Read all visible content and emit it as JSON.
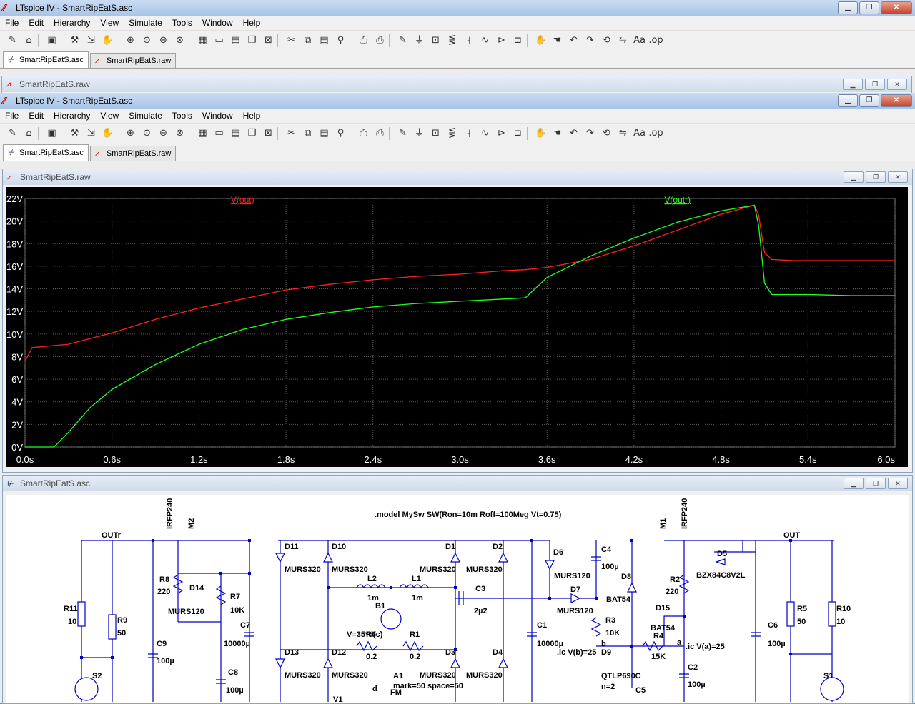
{
  "back_window": {
    "title": "LTspice IV - SmartRipEatS.asc",
    "menu": [
      "File",
      "Edit",
      "Hierarchy",
      "View",
      "Simulate",
      "Tools",
      "Window",
      "Help"
    ],
    "tabs": [
      "SmartRipEatS.asc",
      "SmartRipEatS.raw"
    ],
    "child_title": "SmartRipEatS.raw"
  },
  "main_window": {
    "title": "LTspice IV - SmartRipEatS.asc",
    "menu": [
      "File",
      "Edit",
      "Hierarchy",
      "View",
      "Simulate",
      "Tools",
      "Window",
      "Help"
    ],
    "tabs": [
      "SmartRipEatS.asc",
      "SmartRipEatS.raw"
    ]
  },
  "toolbar_icons": [
    "new-schematic-icon",
    "open-icon",
    "save-icon",
    "control-panel-icon",
    "run-icon",
    "halt-icon",
    "zoom-in-icon",
    "zoom-pan-icon",
    "zoom-out-icon",
    "zoom-cancel-icon",
    "autorange-icon",
    "zoom-extent-icon",
    "tile-icon",
    "cascade-icon",
    "close-window-icon",
    "cut-icon",
    "copy-icon",
    "paste-icon",
    "find-icon",
    "print-setup-icon",
    "print-icon",
    "wire-icon",
    "ground-icon",
    "label-icon",
    "resistor-icon",
    "capacitor-icon",
    "inductor-icon",
    "diode-icon",
    "component-icon",
    "move-icon",
    "drag-icon",
    "undo-icon",
    "redo-icon",
    "rotate-icon",
    "mirror-icon",
    "text-icon",
    "spice-directive-icon"
  ],
  "waveform_window": {
    "title": "SmartRipEatS.raw",
    "colors": {
      "vout": "#ff2020",
      "voutr": "#20ff20",
      "grid": "#5a5a5a",
      "axis_text": "#ffffff"
    }
  },
  "schematic_window": {
    "title": "SmartRipEatS.asc"
  },
  "chart_data": {
    "type": "line",
    "title": "",
    "xlabel": "",
    "ylabel": "",
    "x_ticks": [
      "0.0s",
      "0.6s",
      "1.2s",
      "1.8s",
      "2.4s",
      "3.0s",
      "3.6s",
      "4.2s",
      "4.8s",
      "5.4s",
      "6.0s"
    ],
    "y_ticks": [
      "0V",
      "2V",
      "4V",
      "6V",
      "8V",
      "10V",
      "12V",
      "14V",
      "16V",
      "18V",
      "20V",
      "22V"
    ],
    "xlim": [
      0,
      6.0
    ],
    "ylim": [
      0,
      22
    ],
    "grid": true,
    "series": [
      {
        "name": "V(out)",
        "color": "#ff2020",
        "x": [
          0,
          0.05,
          0.3,
          0.6,
          0.9,
          1.2,
          1.5,
          1.8,
          2.1,
          2.4,
          2.7,
          3.0,
          3.3,
          3.45,
          3.6,
          3.9,
          4.2,
          4.5,
          4.8,
          5.03,
          5.06,
          5.1,
          5.15,
          5.3,
          5.5,
          5.8,
          6.0
        ],
        "y": [
          7.6,
          8.8,
          9.1,
          10.1,
          11.3,
          12.3,
          13.1,
          13.9,
          14.4,
          14.8,
          15.1,
          15.3,
          15.6,
          15.7,
          15.9,
          16.6,
          17.8,
          19.2,
          20.6,
          21.4,
          20.5,
          17.2,
          16.6,
          16.5,
          16.5,
          16.5,
          16.5
        ]
      },
      {
        "name": "V(outr)",
        "color": "#20ff20",
        "x": [
          0,
          0.2,
          0.3,
          0.45,
          0.6,
          0.9,
          1.2,
          1.5,
          1.8,
          2.1,
          2.4,
          2.7,
          3.0,
          3.3,
          3.45,
          3.6,
          3.9,
          4.2,
          4.5,
          4.8,
          5.03,
          5.06,
          5.1,
          5.15,
          5.4,
          5.7,
          6.0
        ],
        "y": [
          0,
          0,
          1.3,
          3.5,
          5.1,
          7.3,
          9.1,
          10.4,
          11.3,
          11.9,
          12.4,
          12.7,
          12.9,
          13.1,
          13.2,
          15.0,
          16.9,
          18.5,
          19.9,
          20.9,
          21.4,
          19.6,
          14.5,
          13.5,
          13.5,
          13.4,
          13.4
        ]
      }
    ]
  },
  "schematic": {
    "directive": ".model MySw SW(Ron=10m Roff=100Meg Vt=0.75)",
    "texts": [
      "OUTr",
      "OUT",
      "IRFP240",
      "M2",
      "M1",
      "IRFP240",
      "D11",
      "D10",
      "D1",
      "D2",
      "D6",
      "C4",
      "100µ",
      "D8",
      "D5",
      "BZX84C8V2L",
      "MURS320",
      "MURS320",
      "MURS320",
      "MURS320",
      "MURS120",
      "BAT54",
      "R2",
      "220",
      "R8",
      "220",
      "D14",
      "R7",
      "10K",
      "MURS120",
      "C7",
      "10000µ",
      "L2",
      "1m",
      "L1",
      "1m",
      "C3",
      "2µ2",
      "D7",
      "MURS120",
      "R3",
      "10K",
      "B1",
      "V=35*d(c)",
      "R6",
      "0.2",
      "R1",
      "0.2",
      "C1",
      "10000µ",
      ".ic V(b)=25",
      "D9",
      "QTLP690C",
      "n=2",
      "D15",
      "BAT54",
      "R4",
      "15K",
      "a",
      ".ic V(a)=25",
      "C2",
      "100µ",
      "C5",
      "R11",
      "10",
      "R9",
      "50",
      "C9",
      "100µ",
      "C8",
      "100µ",
      "S2",
      "D13",
      "D12",
      "D3",
      "D4",
      "MURS320",
      "MURS320",
      "MURS320",
      "MURS320",
      "A1",
      "mark=50 space=50",
      "V1",
      "d",
      "FM",
      "R5",
      "50",
      "R10",
      "10",
      "C6",
      "100µ",
      "S1",
      "b"
    ]
  }
}
